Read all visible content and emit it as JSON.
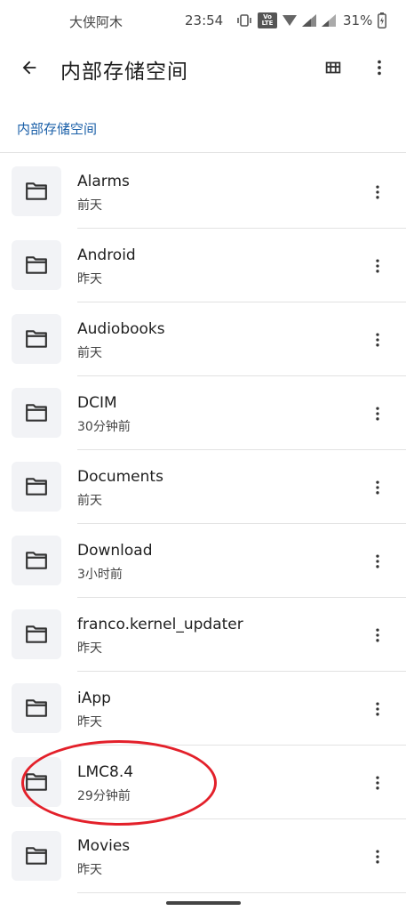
{
  "status_bar": {
    "carrier": "大侠阿木",
    "time": "23:54",
    "battery_percent": "31%",
    "lte_top": "Vo",
    "lte_bottom": "LTE"
  },
  "app_bar": {
    "title": "内部存储空间",
    "back_icon": "arrow-back-icon",
    "grid_icon": "grid-view-icon",
    "more_icon": "more-vert-icon"
  },
  "breadcrumb": {
    "items": [
      "内部存储空间"
    ]
  },
  "files": [
    {
      "name": "Alarms",
      "date": "前天"
    },
    {
      "name": "Android",
      "date": "昨天"
    },
    {
      "name": "Audiobooks",
      "date": "前天"
    },
    {
      "name": "DCIM",
      "date": "30分钟前"
    },
    {
      "name": "Documents",
      "date": "前天"
    },
    {
      "name": "Download",
      "date": "3小时前"
    },
    {
      "name": "franco.kernel_updater",
      "date": "昨天"
    },
    {
      "name": "iApp",
      "date": "昨天"
    },
    {
      "name": "LMC8.4",
      "date": "29分钟前"
    },
    {
      "name": "Movies",
      "date": "昨天"
    }
  ],
  "colors": {
    "accent": "#1a5fa8",
    "highlight": "#e3202a",
    "divider": "#e2e2e2"
  }
}
